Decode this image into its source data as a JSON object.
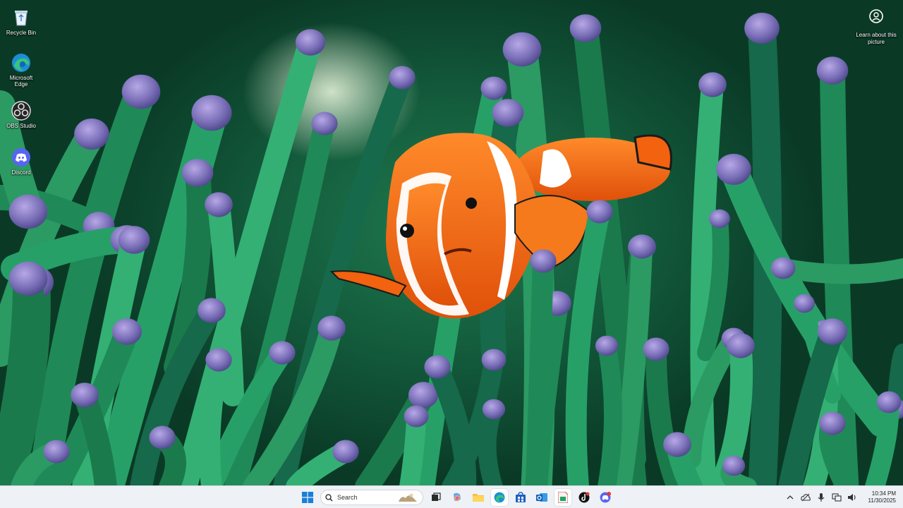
{
  "desktop_icons": [
    {
      "label": "Recycle Bin",
      "icon": "recycle-bin-icon"
    },
    {
      "label": "Microsoft Edge",
      "icon": "edge-icon"
    },
    {
      "label": "OBS Studio",
      "icon": "obs-icon"
    },
    {
      "label": "Discord",
      "icon": "discord-icon"
    }
  ],
  "spotlight": {
    "label": "Learn about this picture",
    "icon": "camera-icon"
  },
  "taskbar": {
    "search_placeholder": "Search",
    "apps": [
      "start",
      "search",
      "task-view",
      "copilot",
      "file-explorer",
      "edge",
      "store",
      "outlook",
      "sheets",
      "tiktok",
      "discord"
    ],
    "clock_time": "10:34 PM",
    "clock_date": "11/30/2025"
  },
  "colors": {
    "taskbar_bg": "#eef1f5",
    "tentacle_green": "#2c9a63",
    "tentacle_tip": "#7a6fb8",
    "clownfish_orange": "#f2620f"
  }
}
